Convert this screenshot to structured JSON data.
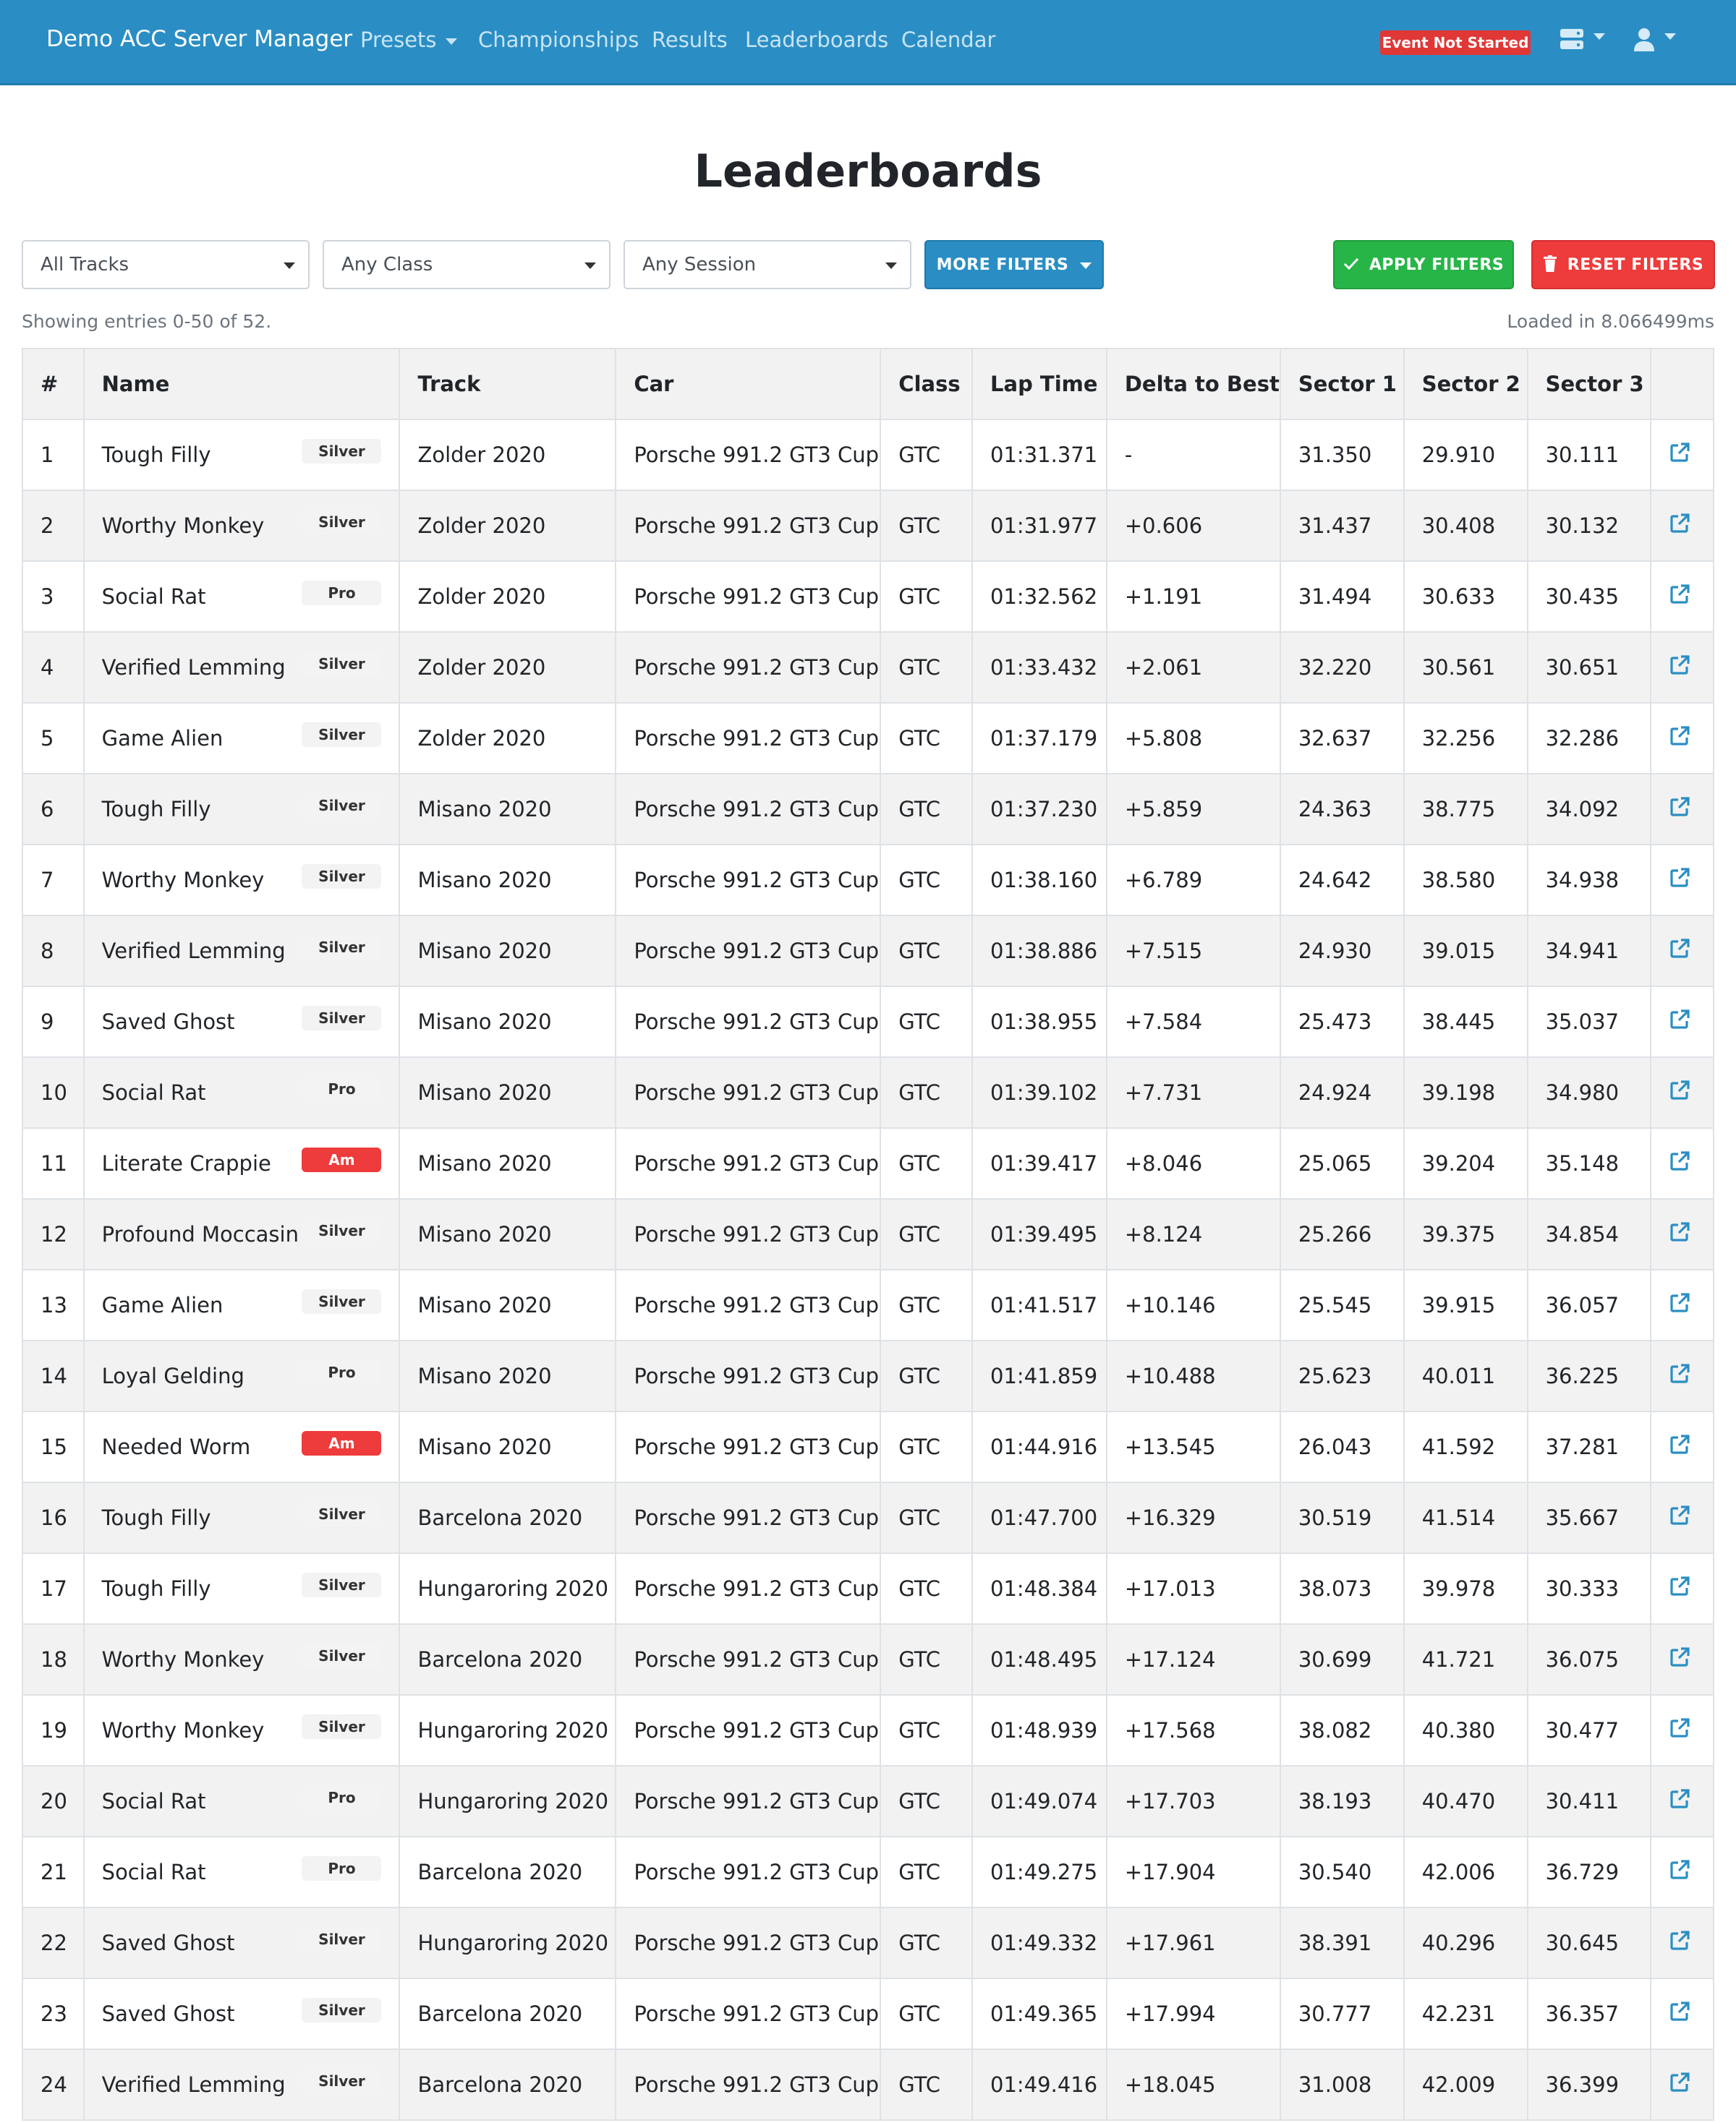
{
  "navbar": {
    "brand": "Demo ACC Server Manager",
    "links": [
      "Presets",
      "Championships",
      "Results",
      "Leaderboards",
      "Calendar"
    ],
    "event_status": "Event Not Started",
    "icons": [
      "server-icon",
      "user-icon"
    ]
  },
  "page": {
    "title": "Leaderboards",
    "showing": "Showing entries 0-50 of 52.",
    "loaded": "Loaded in 8.066499ms"
  },
  "filters": {
    "track": "All Tracks",
    "class": "Any Class",
    "session": "Any Session",
    "more_label": "MORE FILTERS",
    "apply_label": "APPLY FILTERS",
    "reset_label": "RESET FILTERS"
  },
  "colors": {
    "navbar": "#2a8ec4",
    "apply": "#28b548",
    "reset": "#ee3b3b",
    "badge_am": "#ee3b3b",
    "link_icon": "#2a8ec4"
  },
  "table": {
    "headers": [
      "#",
      "Name",
      "Track",
      "Car",
      "Class",
      "Lap Time",
      "Delta to Best",
      "Sector 1",
      "Sector 2",
      "Sector 3",
      ""
    ],
    "rows": [
      {
        "num": "1",
        "name": "Tough Filly",
        "rating": "Silver",
        "track": "Zolder 2020",
        "car": "Porsche 991.2 GT3 Cup",
        "cls": "GTC",
        "lap": "01:31.371",
        "delta": "-",
        "s1": "31.350",
        "s2": "29.910",
        "s3": "30.111"
      },
      {
        "num": "2",
        "name": "Worthy Monkey",
        "rating": "Silver",
        "track": "Zolder 2020",
        "car": "Porsche 991.2 GT3 Cup",
        "cls": "GTC",
        "lap": "01:31.977",
        "delta": "+0.606",
        "s1": "31.437",
        "s2": "30.408",
        "s3": "30.132"
      },
      {
        "num": "3",
        "name": "Social Rat",
        "rating": "Pro",
        "track": "Zolder 2020",
        "car": "Porsche 991.2 GT3 Cup",
        "cls": "GTC",
        "lap": "01:32.562",
        "delta": "+1.191",
        "s1": "31.494",
        "s2": "30.633",
        "s3": "30.435"
      },
      {
        "num": "4",
        "name": "Verified Lemming",
        "rating": "Silver",
        "track": "Zolder 2020",
        "car": "Porsche 991.2 GT3 Cup",
        "cls": "GTC",
        "lap": "01:33.432",
        "delta": "+2.061",
        "s1": "32.220",
        "s2": "30.561",
        "s3": "30.651"
      },
      {
        "num": "5",
        "name": "Game Alien",
        "rating": "Silver",
        "track": "Zolder 2020",
        "car": "Porsche 991.2 GT3 Cup",
        "cls": "GTC",
        "lap": "01:37.179",
        "delta": "+5.808",
        "s1": "32.637",
        "s2": "32.256",
        "s3": "32.286"
      },
      {
        "num": "6",
        "name": "Tough Filly",
        "rating": "Silver",
        "track": "Misano 2020",
        "car": "Porsche 991.2 GT3 Cup",
        "cls": "GTC",
        "lap": "01:37.230",
        "delta": "+5.859",
        "s1": "24.363",
        "s2": "38.775",
        "s3": "34.092"
      },
      {
        "num": "7",
        "name": "Worthy Monkey",
        "rating": "Silver",
        "track": "Misano 2020",
        "car": "Porsche 991.2 GT3 Cup",
        "cls": "GTC",
        "lap": "01:38.160",
        "delta": "+6.789",
        "s1": "24.642",
        "s2": "38.580",
        "s3": "34.938"
      },
      {
        "num": "8",
        "name": "Verified Lemming",
        "rating": "Silver",
        "track": "Misano 2020",
        "car": "Porsche 991.2 GT3 Cup",
        "cls": "GTC",
        "lap": "01:38.886",
        "delta": "+7.515",
        "s1": "24.930",
        "s2": "39.015",
        "s3": "34.941"
      },
      {
        "num": "9",
        "name": "Saved Ghost",
        "rating": "Silver",
        "track": "Misano 2020",
        "car": "Porsche 991.2 GT3 Cup",
        "cls": "GTC",
        "lap": "01:38.955",
        "delta": "+7.584",
        "s1": "25.473",
        "s2": "38.445",
        "s3": "35.037"
      },
      {
        "num": "10",
        "name": "Social Rat",
        "rating": "Pro",
        "track": "Misano 2020",
        "car": "Porsche 991.2 GT3 Cup",
        "cls": "GTC",
        "lap": "01:39.102",
        "delta": "+7.731",
        "s1": "24.924",
        "s2": "39.198",
        "s3": "34.980"
      },
      {
        "num": "11",
        "name": "Literate Crappie",
        "rating": "Am",
        "track": "Misano 2020",
        "car": "Porsche 991.2 GT3 Cup",
        "cls": "GTC",
        "lap": "01:39.417",
        "delta": "+8.046",
        "s1": "25.065",
        "s2": "39.204",
        "s3": "35.148"
      },
      {
        "num": "12",
        "name": "Profound Moccasin",
        "rating": "Silver",
        "track": "Misano 2020",
        "car": "Porsche 991.2 GT3 Cup",
        "cls": "GTC",
        "lap": "01:39.495",
        "delta": "+8.124",
        "s1": "25.266",
        "s2": "39.375",
        "s3": "34.854"
      },
      {
        "num": "13",
        "name": "Game Alien",
        "rating": "Silver",
        "track": "Misano 2020",
        "car": "Porsche 991.2 GT3 Cup",
        "cls": "GTC",
        "lap": "01:41.517",
        "delta": "+10.146",
        "s1": "25.545",
        "s2": "39.915",
        "s3": "36.057"
      },
      {
        "num": "14",
        "name": "Loyal Gelding",
        "rating": "Pro",
        "track": "Misano 2020",
        "car": "Porsche 991.2 GT3 Cup",
        "cls": "GTC",
        "lap": "01:41.859",
        "delta": "+10.488",
        "s1": "25.623",
        "s2": "40.011",
        "s3": "36.225"
      },
      {
        "num": "15",
        "name": "Needed Worm",
        "rating": "Am",
        "track": "Misano 2020",
        "car": "Porsche 991.2 GT3 Cup",
        "cls": "GTC",
        "lap": "01:44.916",
        "delta": "+13.545",
        "s1": "26.043",
        "s2": "41.592",
        "s3": "37.281"
      },
      {
        "num": "16",
        "name": "Tough Filly",
        "rating": "Silver",
        "track": "Barcelona 2020",
        "car": "Porsche 991.2 GT3 Cup",
        "cls": "GTC",
        "lap": "01:47.700",
        "delta": "+16.329",
        "s1": "30.519",
        "s2": "41.514",
        "s3": "35.667"
      },
      {
        "num": "17",
        "name": "Tough Filly",
        "rating": "Silver",
        "track": "Hungaroring 2020",
        "car": "Porsche 991.2 GT3 Cup",
        "cls": "GTC",
        "lap": "01:48.384",
        "delta": "+17.013",
        "s1": "38.073",
        "s2": "39.978",
        "s3": "30.333"
      },
      {
        "num": "18",
        "name": "Worthy Monkey",
        "rating": "Silver",
        "track": "Barcelona 2020",
        "car": "Porsche 991.2 GT3 Cup",
        "cls": "GTC",
        "lap": "01:48.495",
        "delta": "+17.124",
        "s1": "30.699",
        "s2": "41.721",
        "s3": "36.075"
      },
      {
        "num": "19",
        "name": "Worthy Monkey",
        "rating": "Silver",
        "track": "Hungaroring 2020",
        "car": "Porsche 991.2 GT3 Cup",
        "cls": "GTC",
        "lap": "01:48.939",
        "delta": "+17.568",
        "s1": "38.082",
        "s2": "40.380",
        "s3": "30.477"
      },
      {
        "num": "20",
        "name": "Social Rat",
        "rating": "Pro",
        "track": "Hungaroring 2020",
        "car": "Porsche 991.2 GT3 Cup",
        "cls": "GTC",
        "lap": "01:49.074",
        "delta": "+17.703",
        "s1": "38.193",
        "s2": "40.470",
        "s3": "30.411"
      },
      {
        "num": "21",
        "name": "Social Rat",
        "rating": "Pro",
        "track": "Barcelona 2020",
        "car": "Porsche 991.2 GT3 Cup",
        "cls": "GTC",
        "lap": "01:49.275",
        "delta": "+17.904",
        "s1": "30.540",
        "s2": "42.006",
        "s3": "36.729"
      },
      {
        "num": "22",
        "name": "Saved Ghost",
        "rating": "Silver",
        "track": "Hungaroring 2020",
        "car": "Porsche 991.2 GT3 Cup",
        "cls": "GTC",
        "lap": "01:49.332",
        "delta": "+17.961",
        "s1": "38.391",
        "s2": "40.296",
        "s3": "30.645"
      },
      {
        "num": "23",
        "name": "Saved Ghost",
        "rating": "Silver",
        "track": "Barcelona 2020",
        "car": "Porsche 991.2 GT3 Cup",
        "cls": "GTC",
        "lap": "01:49.365",
        "delta": "+17.994",
        "s1": "30.777",
        "s2": "42.231",
        "s3": "36.357"
      },
      {
        "num": "24",
        "name": "Verified Lemming",
        "rating": "Silver",
        "track": "Barcelona 2020",
        "car": "Porsche 991.2 GT3 Cup",
        "cls": "GTC",
        "lap": "01:49.416",
        "delta": "+18.045",
        "s1": "31.008",
        "s2": "42.009",
        "s3": "36.399"
      }
    ]
  }
}
